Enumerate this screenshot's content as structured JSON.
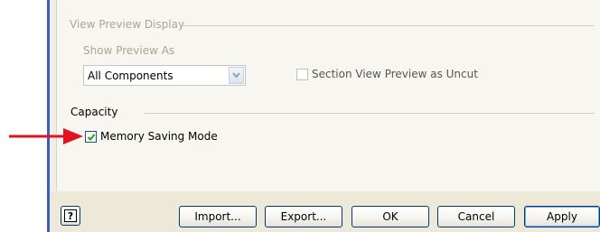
{
  "view_preview": {
    "group_title": "View Preview Display",
    "show_preview_label": "Show Preview As",
    "show_preview_value": "All Components",
    "section_view_label": "Section View Preview as Uncut",
    "section_view_checked": false
  },
  "capacity": {
    "group_title": "Capacity",
    "memory_saving_label": "Memory Saving Mode",
    "memory_saving_checked": true
  },
  "buttons": {
    "help_icon": "question-mark-icon",
    "import": "Import...",
    "export": "Export...",
    "ok": "OK",
    "cancel": "Cancel",
    "apply": "Apply"
  },
  "colors": {
    "pointer_arrow": "#e0141b",
    "checkmark": "#21a121",
    "window_border": "#3a5db5"
  }
}
